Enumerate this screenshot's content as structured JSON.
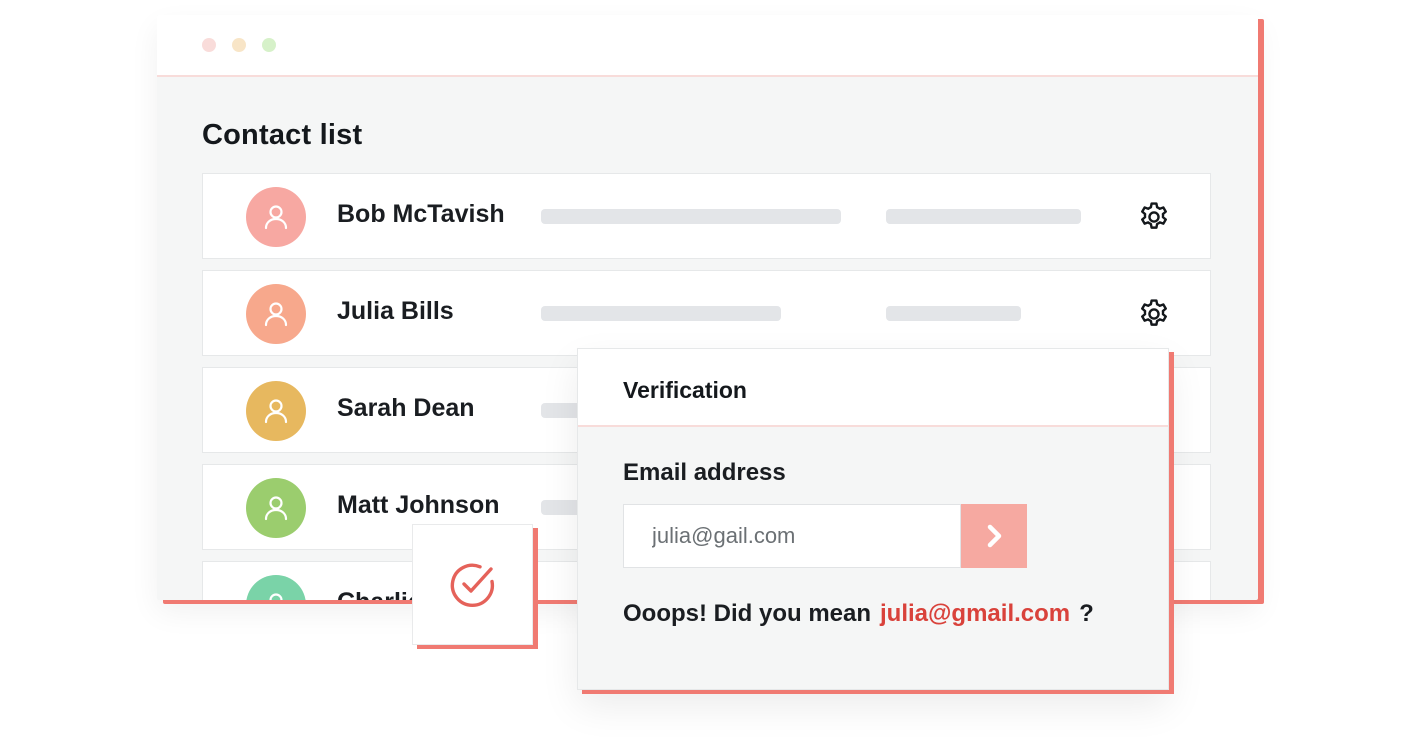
{
  "window": {
    "dots": [
      {
        "name": "close",
        "color": "#f9dcda"
      },
      {
        "name": "minimize",
        "color": "#f8e5c7"
      },
      {
        "name": "maximize",
        "color": "#d6f1c9"
      }
    ]
  },
  "contact_list": {
    "title": "Contact list",
    "contacts": [
      {
        "name": "Bob McTavish",
        "avatar_color": "#f7a8a2",
        "icon": "settings-icon"
      },
      {
        "name": "Julia Bills",
        "avatar_color": "#f7a88c",
        "icon": "settings-icon"
      },
      {
        "name": "Sarah Dean",
        "avatar_color": "#e7b85f",
        "icon": null
      },
      {
        "name": "Matt Johnson",
        "avatar_color": "#9bcd6e",
        "icon": null
      },
      {
        "name": "Charlie",
        "avatar_color": "#7ad3a8",
        "icon": null
      }
    ]
  },
  "check_card": {
    "icon": "check-circle-icon",
    "color": "#e5625a"
  },
  "verification": {
    "title": "Verification",
    "field_label": "Email address",
    "email_value": "julia@gail.com",
    "submit_icon": "chevron-right-icon",
    "suggestion_prefix": "Ooops! Did you mean",
    "suggestion_email": "julia@gmail.com",
    "suggestion_suffix": "?",
    "accent_color": "#d9423b"
  }
}
